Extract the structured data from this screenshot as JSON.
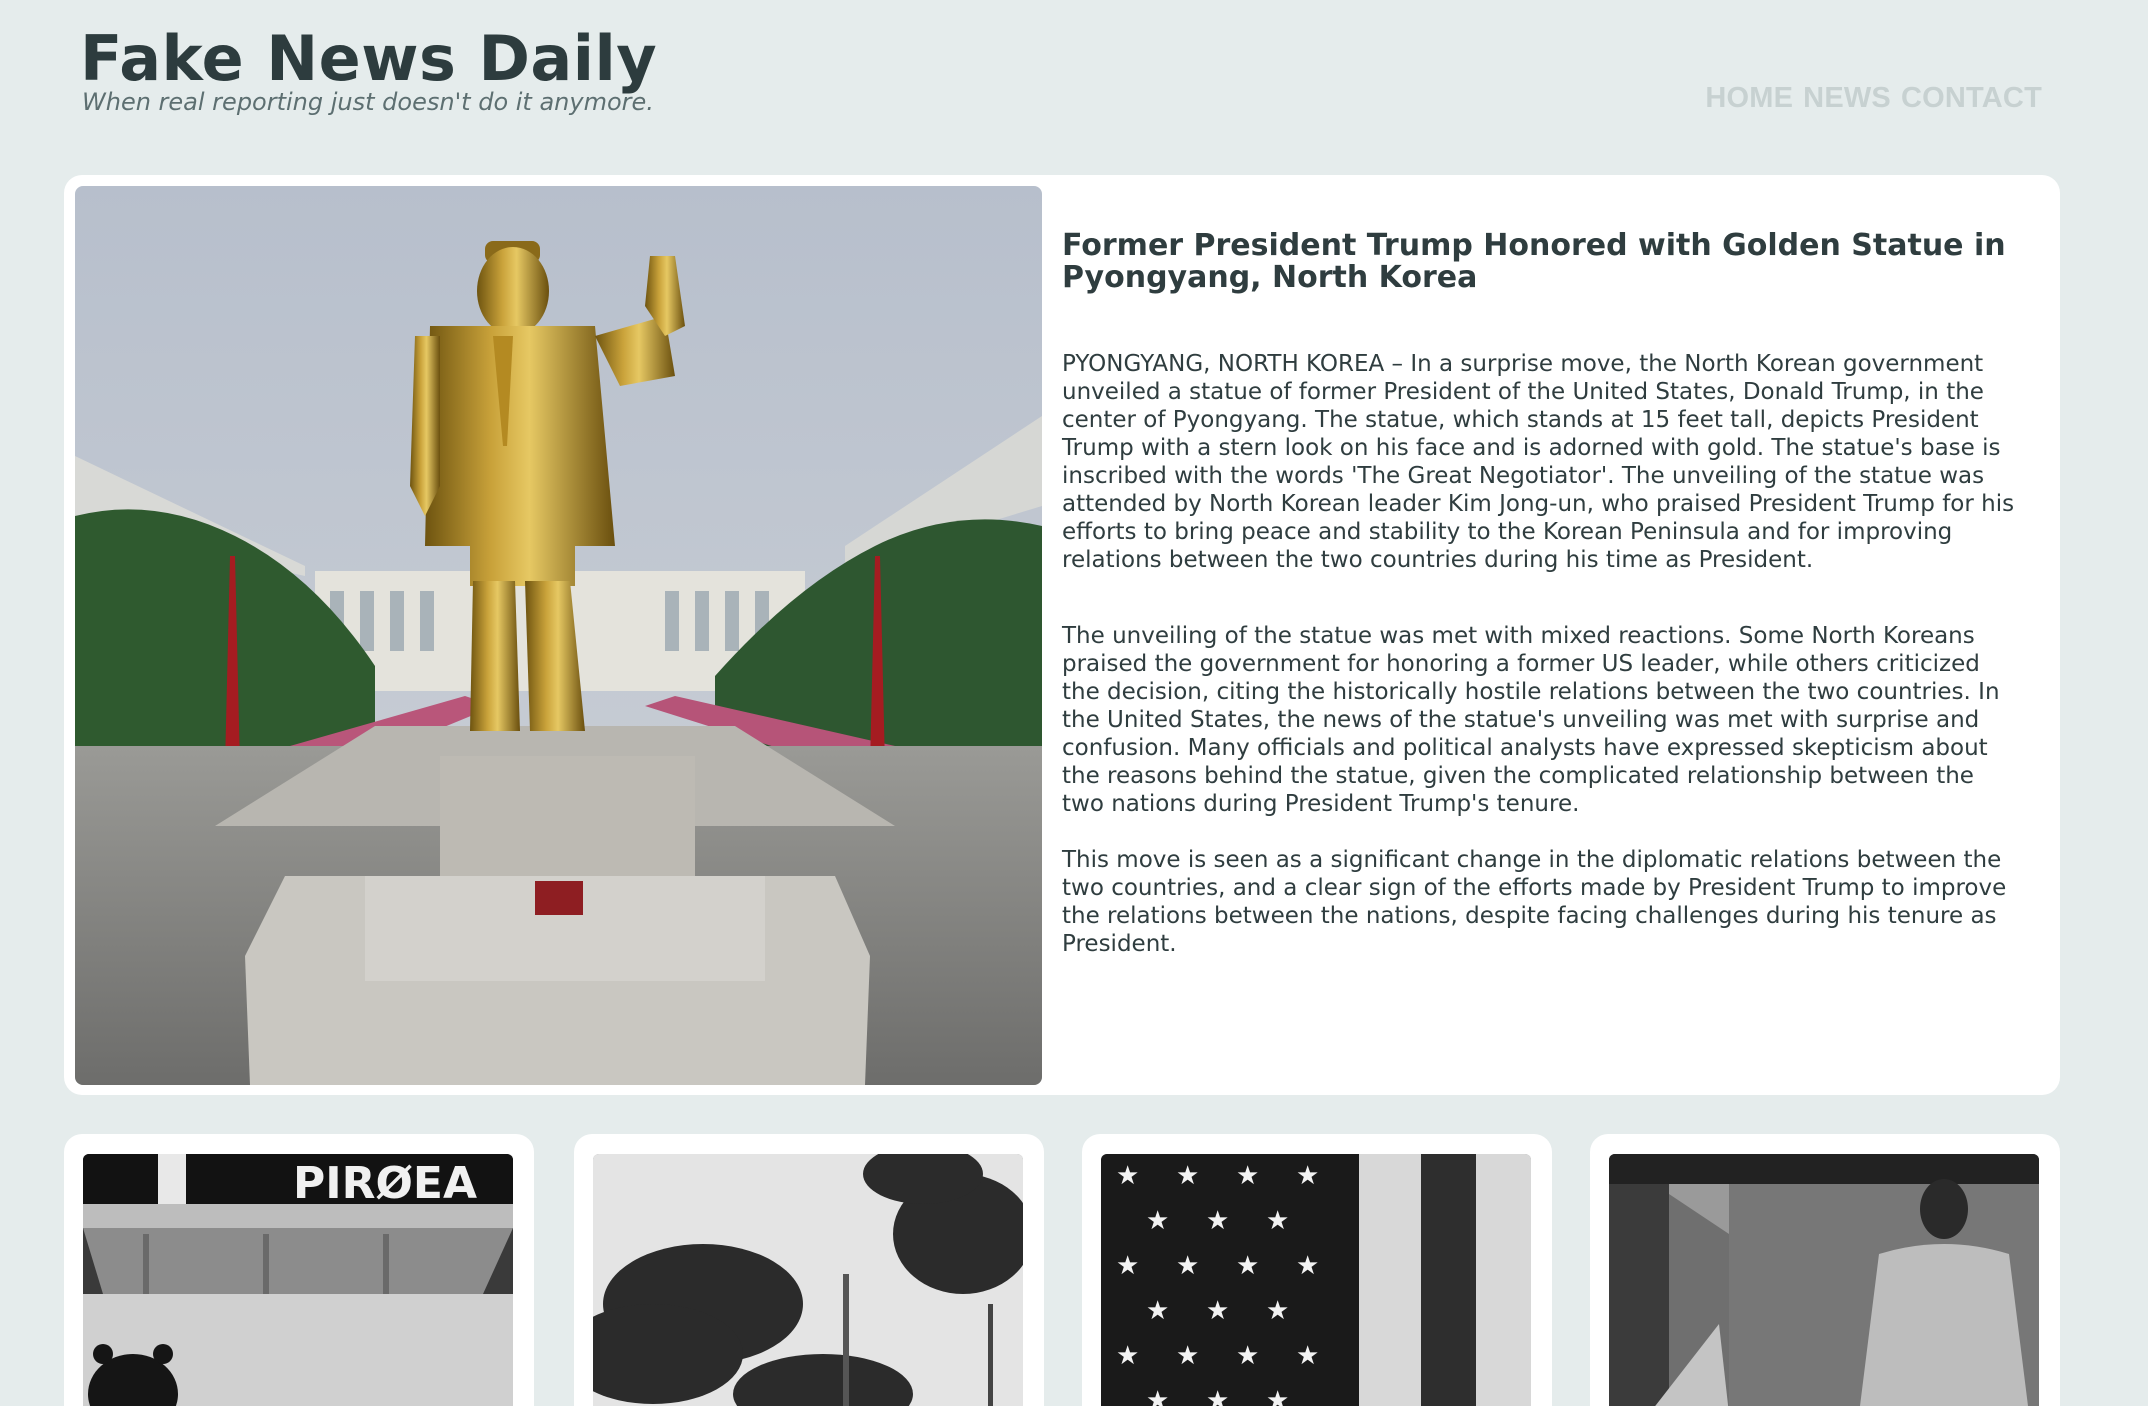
{
  "header": {
    "title": "Fake News Daily",
    "tagline": "When real reporting just doesn't do it anymore.",
    "nav": [
      "HOME",
      "NEWS",
      "CONTACT"
    ]
  },
  "feature": {
    "image_icon": "golden-statue-photo",
    "headline": "Former President Trump Honored with Golden Statue in Pyongyang, North Korea",
    "paragraphs": [
      "PYONGYANG, NORTH KOREA – In a surprise move, the North Korean government unveiled a statue of former President of the United States, Donald Trump, in the center of Pyongyang. The statue, which stands at 15 feet tall, depicts President Trump with a stern look on his face and is adorned with gold. The statue's base is inscribed with the words 'The Great Negotiator'. The unveiling of the statue was attended by North Korean leader Kim Jong-un, who praised President Trump for his efforts to bring peace and stability to the Korean Peninsula and for improving relations between the two countries during his time as President.",
      "The unveiling of the statue was met with mixed reactions. Some North Koreans praised the government for honoring a former US leader, while others criticized the decision, citing the historically hostile relations between the two countries. In the United States, the news of the statue's unveiling was met with surprise and confusion. Many officials and political analysts have expressed skepticism about the reasons behind the statue, given the complicated relationship between the two nations during President Trump's tenure.",
      "This move is seen as a significant change in the diplomatic relations between the two countries, and a clear sign of the efforts made by President Trump to improve the relations between the nations, despite facing challenges during his tenure as President."
    ]
  },
  "cards": [
    {
      "image_icon": "bear-storefront-photo",
      "sign_text": "PIRØEA"
    },
    {
      "image_icon": "palm-trees-photo"
    },
    {
      "image_icon": "american-flag-photo"
    },
    {
      "image_icon": "man-in-alley-photo"
    }
  ]
}
